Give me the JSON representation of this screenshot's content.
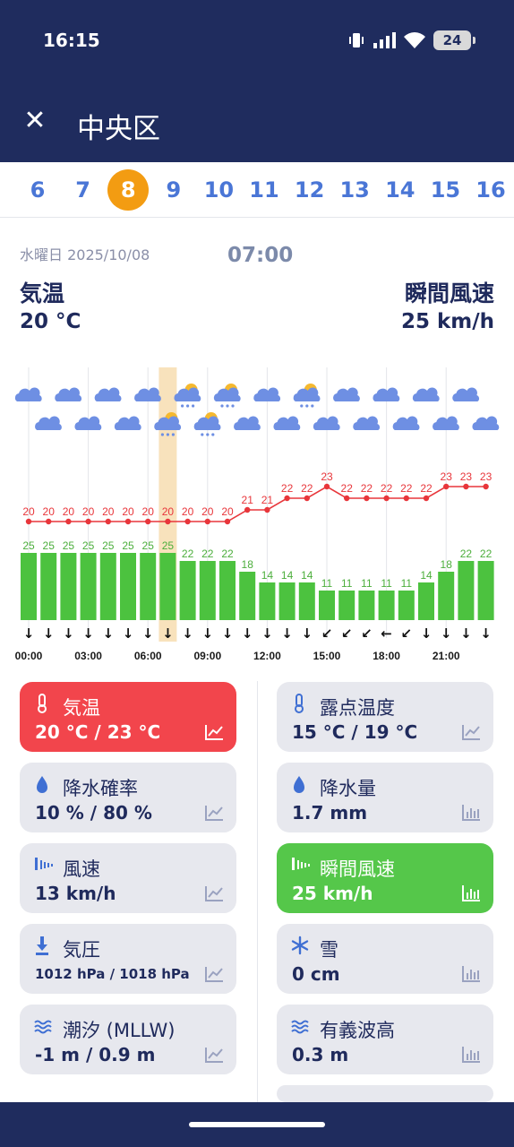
{
  "status": {
    "time": "16:15",
    "battery": "24"
  },
  "header": {
    "close": "✕",
    "title": "中央区"
  },
  "days": [
    "6",
    "7",
    "8",
    "9",
    "10",
    "11",
    "12",
    "13",
    "14",
    "15",
    "16"
  ],
  "selected_day": "8",
  "summary": {
    "date": "水曜日 2025/10/08",
    "time": "07:00",
    "left_label": "気温",
    "left_value": "20 °C",
    "right_label": "瞬間風速",
    "right_value": "25 km/h"
  },
  "chart_data": {
    "type": "bar",
    "x_ticks": [
      "00:00",
      "03:00",
      "06:00",
      "09:00",
      "12:00",
      "15:00",
      "18:00",
      "21:00"
    ],
    "hours": [
      0,
      1,
      2,
      3,
      4,
      5,
      6,
      7,
      8,
      9,
      10,
      11,
      12,
      13,
      14,
      15,
      16,
      17,
      18,
      19,
      20,
      21,
      22,
      23
    ],
    "selected_hour": 7,
    "series": [
      {
        "values": [
          20,
          20,
          20,
          20,
          20,
          20,
          20,
          20,
          20,
          20,
          20,
          21,
          21,
          22,
          22,
          23,
          22,
          22,
          22,
          22,
          22,
          23,
          23,
          23
        ],
        "color": "#e8363b"
      },
      {
        "values": [
          25,
          25,
          25,
          25,
          25,
          25,
          25,
          25,
          22,
          22,
          22,
          18,
          14,
          14,
          14,
          11,
          11,
          11,
          11,
          11,
          14,
          18,
          22,
          22
        ],
        "color": "#4cc23f"
      }
    ],
    "icons": [
      "cloud",
      "cloud",
      "cloud",
      "cloud",
      "cloud",
      "cloud",
      "cloud",
      "sun-rain",
      "sun-rain",
      "sun-rain",
      "sun-rain",
      "cloud",
      "cloud",
      "cloud",
      "sun-rain",
      "cloud",
      "cloud",
      "cloud",
      "cloud",
      "cloud",
      "cloud",
      "cloud",
      "cloud",
      "cloud"
    ],
    "wind_dir": [
      "↓",
      "↓",
      "↓",
      "↓",
      "↓",
      "↓",
      "↓",
      "↓",
      "↓",
      "↓",
      "↓",
      "↓",
      "↓",
      "↓",
      "↓",
      "↙",
      "↙",
      "↙",
      "←",
      "↙",
      "↓",
      "↓",
      "↓",
      "↓"
    ]
  },
  "cards": [
    {
      "icon": "thermometer-icon",
      "label": "気温",
      "value": "20 °C / 23 °C",
      "graph": "line",
      "style": "red"
    },
    {
      "icon": "thermometer-icon",
      "label": "露点温度",
      "value": "15 °C / 19 °C",
      "graph": "line",
      "style": "gray"
    },
    {
      "icon": "drop-icon",
      "label": "降水確率",
      "value": "10 % / 80 %",
      "graph": "line",
      "style": "gray"
    },
    {
      "icon": "drop-icon",
      "label": "降水量",
      "value": "1.7 mm",
      "graph": "bar",
      "style": "gray"
    },
    {
      "icon": "wind-icon",
      "label": "風速",
      "value": "13 km/h",
      "graph": "line",
      "style": "gray"
    },
    {
      "icon": "wind-icon",
      "label": "瞬間風速",
      "value": "25 km/h",
      "graph": "bar",
      "style": "green"
    },
    {
      "icon": "pressure-icon",
      "label": "気圧",
      "value": "1012 hPa / 1018 hPa",
      "graph": "line",
      "style": "gray"
    },
    {
      "icon": "snowflake-icon",
      "label": "雪",
      "value": "0 cm",
      "graph": "bar",
      "style": "gray"
    },
    {
      "icon": "waves-icon",
      "label": "潮汐 (MLLW)",
      "value": "-1 m / 0.9 m",
      "graph": "line",
      "style": "gray"
    },
    {
      "icon": "waves-icon",
      "label": "有義波高",
      "value": "0.3 m",
      "graph": "bar",
      "style": "gray"
    }
  ]
}
